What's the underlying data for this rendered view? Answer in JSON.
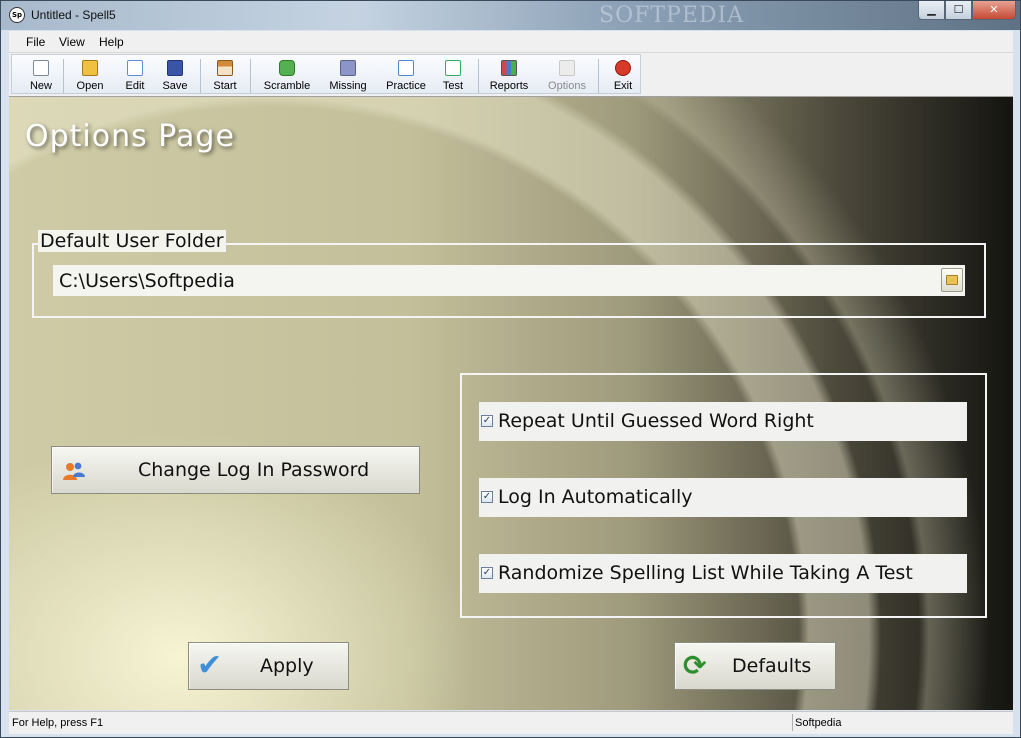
{
  "window": {
    "title": "Untitled - Spell5",
    "app_icon_text": "Sp",
    "watermark": "SOFTPEDIA"
  },
  "window_controls": {
    "minimize": "▁",
    "maximize": "☐",
    "close": "✕"
  },
  "menu": [
    {
      "label": "File"
    },
    {
      "label": "View"
    },
    {
      "label": "Help"
    }
  ],
  "toolbar": [
    {
      "label": "New",
      "icon": "new-document-icon",
      "color": "#ffffff"
    },
    {
      "label": "Open",
      "icon": "open-folder-icon",
      "color": "#f0c040"
    },
    {
      "label": "Edit",
      "icon": "edit-icon",
      "color": "#5a8fd8"
    },
    {
      "label": "Save",
      "icon": "save-icon",
      "color": "#3a55a8"
    },
    {
      "label": "Start",
      "icon": "home-icon",
      "color": "#d08a3a"
    },
    {
      "label": "Scramble",
      "icon": "puzzle-icon",
      "color": "#55b050"
    },
    {
      "label": "Missing",
      "icon": "missing-icon",
      "color": "#8b95c8"
    },
    {
      "label": "Practice",
      "icon": "practice-check-icon",
      "color": "#4a8ad0"
    },
    {
      "label": "Test",
      "icon": "test-check-icon",
      "color": "#3aa860"
    },
    {
      "label": "Reports",
      "icon": "bar-chart-icon",
      "color": "#d04848"
    },
    {
      "label": "Options",
      "icon": "options-icon",
      "color": "#c8c8c8",
      "disabled": true
    },
    {
      "label": "Exit",
      "icon": "exit-icon",
      "color": "#d83a2a"
    }
  ],
  "page": {
    "title": "Options Page",
    "folder_group_label": "Default User Folder",
    "folder_path": "C:\\Users\\Softpedia",
    "options": [
      {
        "label": "Repeat Until Guessed Word Right",
        "checked": true
      },
      {
        "label": "Log In Automatically",
        "checked": true
      },
      {
        "label": "Randomize Spelling List While Taking A Test",
        "checked": true
      }
    ],
    "change_password_label": "Change Log In Password",
    "apply_label": "Apply",
    "defaults_label": "Defaults"
  },
  "status": {
    "help": "For Help, press F1",
    "right": "Softpedia"
  }
}
